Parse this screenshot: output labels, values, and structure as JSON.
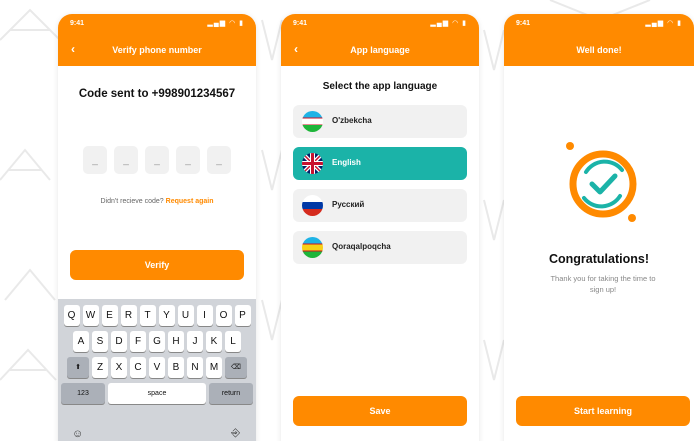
{
  "colors": {
    "accent": "#ff8a00",
    "selected": "#1bb3a8",
    "keyboard": "#d1d4d9"
  },
  "verify_screen": {
    "status_time": "9:41",
    "status_icons": "▂▄▆ ◠ ▮",
    "back": "‹",
    "title": "Verify phone number",
    "code_title": "Code sent to +998901234567",
    "otp": [
      "_",
      "_",
      "_",
      "_",
      "_"
    ],
    "resend_text": "Didn't recieve code?",
    "resend_link": "Request again",
    "button": "Verify",
    "keyboard": {
      "row1": [
        "Q",
        "W",
        "E",
        "R",
        "T",
        "Y",
        "U",
        "I",
        "O",
        "P"
      ],
      "row2": [
        "A",
        "S",
        "D",
        "F",
        "G",
        "H",
        "J",
        "K",
        "L"
      ],
      "row3": [
        "Z",
        "X",
        "C",
        "V",
        "B",
        "N",
        "M"
      ],
      "shift": "⬆",
      "backspace": "⌫",
      "numbers": "123",
      "space": "space",
      "return": "return",
      "emoji": "☺",
      "mic": "⎆"
    }
  },
  "language_screen": {
    "status_time": "9:41",
    "status_icons": "▂▄▆ ◠ ▮",
    "back": "‹",
    "title": "App language",
    "heading": "Select the app language",
    "languages": [
      {
        "label": "O'zbekcha",
        "flag": "uzbekistan-flag",
        "selected": false
      },
      {
        "label": "English",
        "flag": "uk-flag",
        "selected": true
      },
      {
        "label": "Русский",
        "flag": "russia-flag",
        "selected": false
      },
      {
        "label": "Qoraqalpoqcha",
        "flag": "karakalpakstan-flag",
        "selected": false
      }
    ],
    "button": "Save"
  },
  "done_screen": {
    "status_time": "9:41",
    "status_icons": "▂▄▆ ◠ ▮",
    "title": "Well done!",
    "icon": "success-check-icon",
    "heading": "Congratulations!",
    "message": "Thank you for taking the time to sign up!",
    "button": "Start learning"
  }
}
